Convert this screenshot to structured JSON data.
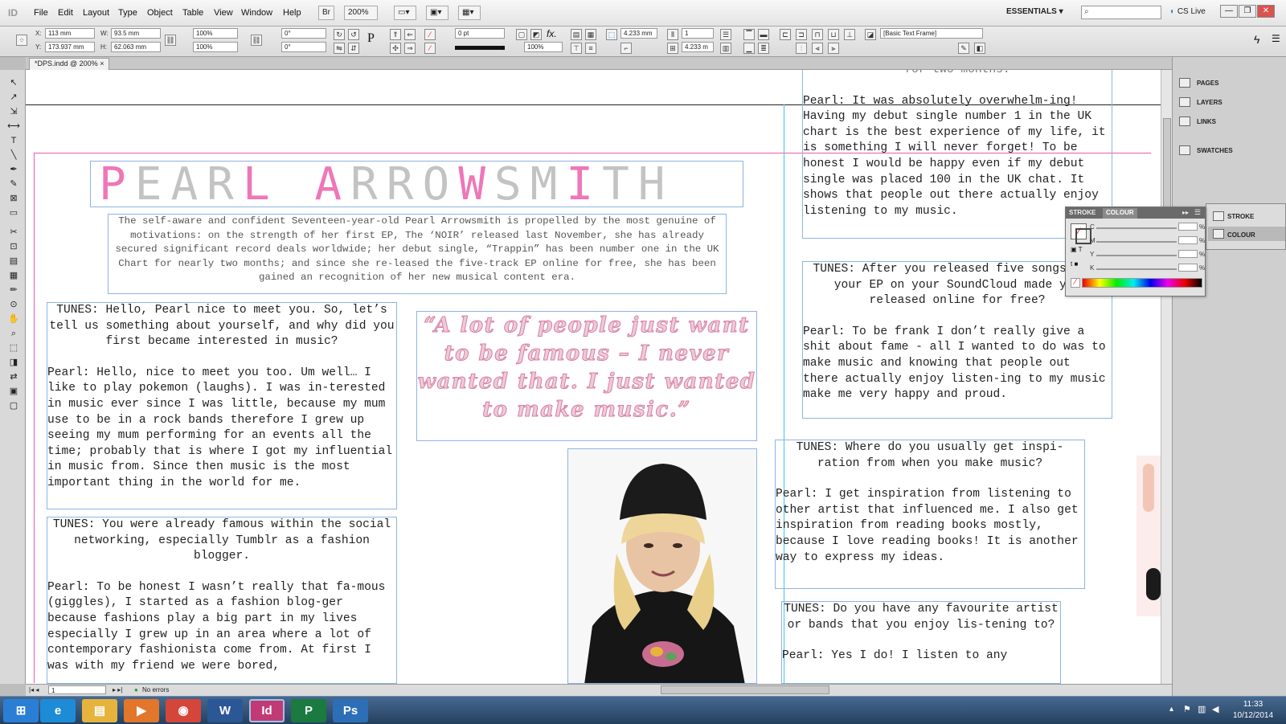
{
  "app": {
    "logo": "ID"
  },
  "menu": [
    "File",
    "Edit",
    "Layout",
    "Type",
    "Object",
    "Table",
    "View",
    "Window",
    "Help"
  ],
  "menubar": {
    "zoom": "200%",
    "workspace": "ESSENTIALS",
    "search_placeholder": "",
    "cs_live": "CS Live",
    "bridge": "Br"
  },
  "control": {
    "x_label": "X:",
    "x": "113 mm",
    "y_label": "Y:",
    "y": "173.937 mm",
    "w_label": "W:",
    "w": "93.5 mm",
    "h_label": "H:",
    "h": "62.063 mm",
    "scale_x": "100%",
    "scale_y": "100%",
    "angle": "0°",
    "shear": "0°",
    "stroke_weight": "0 pt",
    "opacity": "100%",
    "ref_size": "4.233 mm",
    "columns": "1",
    "gutter": "4.233 m",
    "style": "[Basic Text Frame]"
  },
  "doc_tab": {
    "label": "*DPS.indd @ 200%",
    "close": "×"
  },
  "tools": [
    "↖",
    "↗",
    "⇲",
    "⟷",
    "T",
    "╲",
    "✒",
    "✎",
    "⊠",
    "▭",
    "✂",
    "⊡",
    "▤",
    "▦",
    "✏",
    "⊙",
    "✋",
    "⌕",
    "⬚",
    "◨",
    "⇄",
    "▣",
    "▢"
  ],
  "page": {
    "top_text": "for two months.",
    "title": [
      "P",
      "E",
      "A",
      "R",
      "L",
      " ",
      "A",
      "R",
      "R",
      "O",
      "W",
      "S",
      "M",
      "I",
      "T",
      "H"
    ],
    "intro": "The self-aware and confident Seventeen-year-old Pearl Arrowsmith is propelled by the most genuine of motivations: on the strength of her first EP, The ‘NOIR’ released last November, she has already secured significant record deals worldwide; her debut single, “Trappin” has been number one in the UK Chart for nearly two months; and since she re-leased the five-track EP online for free, she has been gained an recognition of her new musical content era.",
    "q1": "TUNES: Hello, Pearl nice to meet you. So, let’s tell us something about yourself, and why did you first became interested in music?",
    "a1": "Pearl: Hello, nice to meet you too. Um well… I like to play pokemon (laughs). I was in-terested in music ever since I was little, because my mum use to be in a rock bands therefore I grew up seeing my mum performing for an events all the time; probably that is where I got my influential in music from. Since then music is the most important thing in the world for me.",
    "q2": "TUNES: You were already famous within the social networking, especially Tumblr as a fashion blogger.",
    "a2": "Pearl: To be honest I wasn’t really that fa-mous (giggles), I started as a fashion blog-ger because fashions play a big part in my lives especially I grew up in an area where a lot of contemporary fashionista come from. At first I was with my friend we were bored,",
    "quote": "“A lot of people just want to be famous – I never wanted that. I just wanted to make music.”",
    "a3": "Pearl: It was absolutely overwhelm-ing! Having my debut single number 1 in the UK chart is the best experience of my life, it is something I will never forget! To be honest I would be happy even if my debut single was placed 100 in the UK chat. It shows that people out there actually enjoy listening to my music.",
    "q4": "TUNES: After you released five songs from your EP on your SoundCloud made you released online for free?",
    "a4": "Pearl: To be frank I don’t really give a shit about fame - all I wanted to do was to make music and knowing that people out there actually enjoy listen-ing to my music make me very happy and proud.",
    "q5": "TUNES: Where do you usually get inspi-ration from when you make music?",
    "a5": "Pearl: I get inspiration from listening to other artist that influenced me. I also get inspiration from reading books mostly, because I love reading books! It is another way to express my ideas.",
    "q6": "TUNES: Do you have any favourite artist or bands that you enjoy lis-tening to?",
    "a6": "Pearl: Yes I do! I listen to any"
  },
  "status": {
    "page": "1",
    "errors": "No errors"
  },
  "panels": {
    "items": [
      "PAGES",
      "LAYERS",
      "LINKS",
      "SWATCHES"
    ],
    "stroke_panel": [
      "STROKE",
      "COLOUR"
    ],
    "colour_tabs": [
      "STROKE",
      "COLOUR"
    ],
    "cmyk": [
      "C",
      "M",
      "Y",
      "K"
    ],
    "pct_sign": "%"
  },
  "taskbar": {
    "apps": [
      {
        "label": "⊞",
        "name": "start-button",
        "color": "#2a7fd4"
      },
      {
        "label": "e",
        "name": "taskbar-ie",
        "color": "#1d8bd6"
      },
      {
        "label": "▤",
        "name": "taskbar-explorer",
        "color": "#e6b43c"
      },
      {
        "label": "▶",
        "name": "taskbar-media",
        "color": "#e2762a"
      },
      {
        "label": "◉",
        "name": "taskbar-chrome",
        "color": "#d5463a"
      },
      {
        "label": "W",
        "name": "taskbar-word",
        "color": "#2b5797"
      },
      {
        "label": "Id",
        "name": "taskbar-indesign",
        "color": "#c13a76"
      },
      {
        "label": "P",
        "name": "taskbar-publisher",
        "color": "#1a7a3f"
      },
      {
        "label": "Ps",
        "name": "taskbar-photoshop",
        "color": "#2d6fb6"
      }
    ],
    "time": "11:33",
    "date": "10/12/2014"
  },
  "colors": {
    "title_pink": "#ee77b8",
    "title_grey": "#c3c3c3",
    "guide_pink": "#ec58b8",
    "frame_blue": "#8fb3e6",
    "quote_pink": "#e8a8c4"
  }
}
